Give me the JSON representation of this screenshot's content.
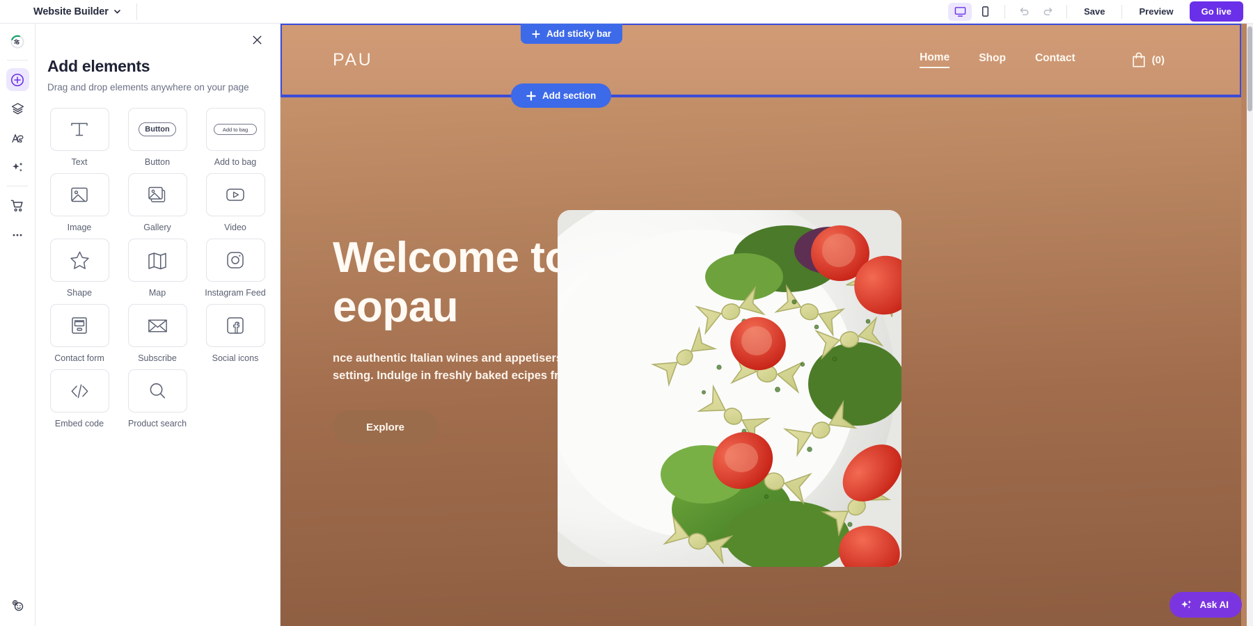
{
  "topbar": {
    "brand": "Website Builder",
    "brand_chevron_icon": "chevron-down-icon",
    "desktop_icon": "desktop-icon",
    "mobile_icon": "mobile-icon",
    "undo_icon": "undo-icon",
    "redo_icon": "redo-icon",
    "save_label": "Save",
    "preview_label": "Preview",
    "golive_label": "Go live",
    "golive_color": "#6a2fe8"
  },
  "rail": {
    "items": [
      {
        "name": "setup-progress",
        "icon": "progress-sliders-icon",
        "active": false
      },
      {
        "name": "add-elements",
        "icon": "plus-circle-icon",
        "active": true
      },
      {
        "name": "layers",
        "icon": "layers-icon",
        "active": false
      },
      {
        "name": "design-theme",
        "icon": "palette-icon",
        "active": false
      },
      {
        "name": "ai-tools",
        "icon": "sparkles-icon",
        "active": false
      },
      {
        "name": "store",
        "icon": "shopping-cart-icon",
        "active": false
      },
      {
        "name": "more",
        "icon": "ellipsis-icon",
        "active": false
      }
    ],
    "bottom_item": {
      "name": "feedback",
      "icon": "smiley-feedback-icon"
    },
    "active_color": "#ece7fe"
  },
  "panel": {
    "close_icon": "close-icon",
    "title": "Add elements",
    "subtitle": "Drag and drop elements anywhere on your page",
    "elements": [
      {
        "label": "Text",
        "icon": "text-t-icon"
      },
      {
        "label": "Button",
        "icon": "button-icon",
        "inner_text": "Button"
      },
      {
        "label": "Add to bag",
        "icon": "add-to-bag-icon",
        "inner_text": "Add to bag"
      },
      {
        "label": "Image",
        "icon": "image-icon"
      },
      {
        "label": "Gallery",
        "icon": "gallery-icon"
      },
      {
        "label": "Video",
        "icon": "video-play-icon"
      },
      {
        "label": "Shape",
        "icon": "star-shape-icon"
      },
      {
        "label": "Map",
        "icon": "map-icon"
      },
      {
        "label": "Instagram Feed",
        "icon": "instagram-icon"
      },
      {
        "label": "Contact form",
        "icon": "contact-form-icon"
      },
      {
        "label": "Subscribe",
        "icon": "envelope-icon"
      },
      {
        "label": "Social icons",
        "icon": "facebook-icon"
      },
      {
        "label": "Embed code",
        "icon": "embed-code-icon"
      },
      {
        "label": "Product search",
        "icon": "search-icon"
      }
    ]
  },
  "canvas": {
    "add_sticky_bar_label": "Add sticky bar",
    "add_section_label": "Add section",
    "plus_icon": "plus-icon",
    "selection_color": "#3c4cd9",
    "pill_color": "#3d6ae8",
    "site": {
      "logo": "PAU",
      "nav": [
        {
          "label": "Home",
          "active": true
        },
        {
          "label": "Shop",
          "active": false
        },
        {
          "label": "Contact",
          "active": false
        }
      ],
      "cart_icon": "shopping-bag-icon",
      "cart_count": "(0)",
      "hero": {
        "heading_line1": "Welcome to",
        "heading_line2": "eopau",
        "paragraph": "nce authentic Italian wines and appetisers in a nd friendly terrace setting. Indulge in freshly baked ecipes from our famous suppliers.",
        "cta_label": "Explore",
        "photo_alt": "pesto-farfalle-pasta-salad-plate"
      },
      "background_color": "#b98360"
    }
  },
  "askai": {
    "label": "Ask AI",
    "icon": "sparkles-icon",
    "color": "#7b35e0"
  }
}
